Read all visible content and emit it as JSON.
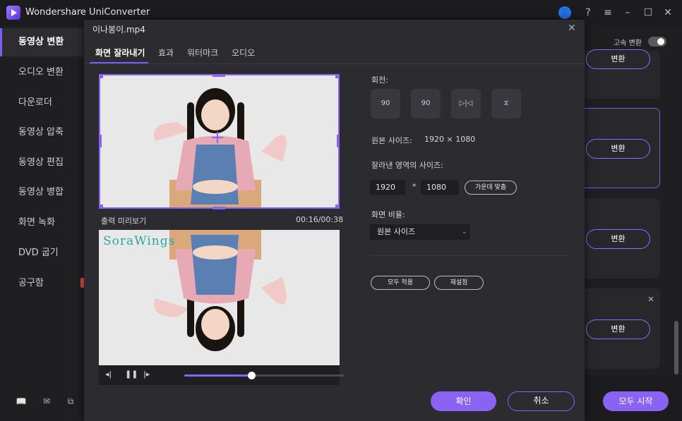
{
  "app": {
    "title": "Wondershare UniConverter"
  },
  "sidebar": {
    "items": [
      {
        "label": "동영상 변환"
      },
      {
        "label": "오디오 변환"
      },
      {
        "label": "다운로더"
      },
      {
        "label": "동영상 압축"
      },
      {
        "label": "동영상 편집"
      },
      {
        "label": "동영상 병합"
      },
      {
        "label": "화면 녹화"
      },
      {
        "label": "DVD 굽기"
      },
      {
        "label": "공구함"
      }
    ]
  },
  "background": {
    "fast_convert_label": "고속 변환",
    "convert_label": "변환",
    "start_all_label": "모두 시작"
  },
  "dialog": {
    "file_name": "이나봉이.mp4",
    "tabs": [
      "화면 잘라내기",
      "효과",
      "워터마크",
      "오디오"
    ],
    "preview_label": "출력 미리보기",
    "time": "00:16/00:38",
    "watermark_text": "SoraWings",
    "rotation_label": "회전:",
    "rotate_buttons": [
      "90",
      "90"
    ],
    "original_size_label": "원본 사이즈:",
    "original_size_value": "1920 × 1080",
    "crop_size_label": "잘라낸 영역의 사이즈:",
    "crop_width": "1920",
    "crop_sep": "*",
    "crop_height": "1080",
    "center_fit_label": "가운데 맞춤",
    "aspect_label": "화면 비율:",
    "aspect_value": "원본 사이즈",
    "apply_all_label": "모두 적용",
    "reset_label": "재설정",
    "ok_label": "확인",
    "cancel_label": "취소",
    "playback_progress": 0.42
  },
  "colors": {
    "accent": "#8a63f5",
    "background": "#1f1f22",
    "dialog": "#2b2b30"
  }
}
